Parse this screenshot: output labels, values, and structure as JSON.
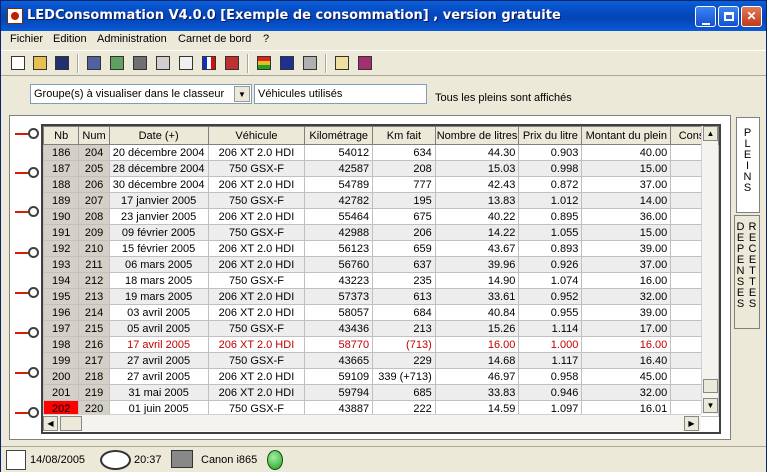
{
  "window": {
    "title": "LEDConsommation V4.0.0 [Exemple de consommation] , version gratuite"
  },
  "menu": [
    "Fichier",
    "Edition",
    "Administration",
    "Carnet de bord",
    "?"
  ],
  "filter": {
    "group_select": "Groupe(s) à visualiser dans le classeur",
    "vehicles_value": "Véhicules utilisés",
    "status": "Tous les pleins sont affichés"
  },
  "table": {
    "columns": [
      "Nb",
      "Num",
      "Date (+)",
      "Véhicule",
      "Kilométrage",
      "Km fait",
      "Nombre de litres",
      "Prix du litre",
      "Montant du plein",
      "Conso"
    ],
    "rows": [
      [
        "186",
        "204",
        "20 décembre 2004",
        "206 XT 2.0 HDI",
        "54012",
        "634",
        "44.30",
        "0.903",
        "40.00"
      ],
      [
        "187",
        "205",
        "28 décembre 2004",
        "750 GSX-F",
        "42587",
        "208",
        "15.03",
        "0.998",
        "15.00"
      ],
      [
        "188",
        "206",
        "30 décembre 2004",
        "206 XT 2.0 HDI",
        "54789",
        "777",
        "42.43",
        "0.872",
        "37.00"
      ],
      [
        "189",
        "207",
        "17 janvier 2005",
        "750 GSX-F",
        "42782",
        "195",
        "13.83",
        "1.012",
        "14.00"
      ],
      [
        "190",
        "208",
        "23 janvier 2005",
        "206 XT 2.0 HDI",
        "55464",
        "675",
        "40.22",
        "0.895",
        "36.00"
      ],
      [
        "191",
        "209",
        "09 février 2005",
        "750 GSX-F",
        "42988",
        "206",
        "14.22",
        "1.055",
        "15.00"
      ],
      [
        "192",
        "210",
        "15 février 2005",
        "206 XT 2.0 HDI",
        "56123",
        "659",
        "43.67",
        "0.893",
        "39.00"
      ],
      [
        "193",
        "211",
        "06 mars 2005",
        "206 XT 2.0 HDI",
        "56760",
        "637",
        "39.96",
        "0.926",
        "37.00"
      ],
      [
        "194",
        "212",
        "18 mars 2005",
        "750 GSX-F",
        "43223",
        "235",
        "14.90",
        "1.074",
        "16.00"
      ],
      [
        "195",
        "213",
        "19 mars 2005",
        "206 XT 2.0 HDI",
        "57373",
        "613",
        "33.61",
        "0.952",
        "32.00"
      ],
      [
        "196",
        "214",
        "03 avril 2005",
        "206 XT 2.0 HDI",
        "58057",
        "684",
        "40.84",
        "0.955",
        "39.00"
      ],
      [
        "197",
        "215",
        "05 avril 2005",
        "750 GSX-F",
        "43436",
        "213",
        "15.26",
        "1.114",
        "17.00"
      ],
      [
        "198",
        "216",
        "17 avril 2005",
        "206 XT 2.0 HDI",
        "58770",
        "(713)",
        "16.00",
        "1.000",
        "16.00"
      ],
      [
        "199",
        "217",
        "27 avril 2005",
        "750 GSX-F",
        "43665",
        "229",
        "14.68",
        "1.117",
        "16.40"
      ],
      [
        "200",
        "218",
        "27 avril 2005",
        "206 XT 2.0 HDI",
        "59109",
        "339 (+713)",
        "46.97",
        "0.958",
        "45.00"
      ],
      [
        "201",
        "219",
        "31 mai 2005",
        "206 XT 2.0 HDI",
        "59794",
        "685",
        "33.83",
        "0.946",
        "32.00"
      ],
      [
        "202",
        "220",
        "01 juin 2005",
        "750 GSX-F",
        "43887",
        "222",
        "14.59",
        "1.097",
        "16.01"
      ]
    ],
    "highlight_row": 12,
    "current_row": 16
  },
  "tabs": {
    "pleins": "PLEINS",
    "depenses": "DEPENSES",
    "recettes": "RECETTES"
  },
  "statusbar": {
    "date": "14/08/2005",
    "time": "20:37",
    "printer": "Canon i865"
  },
  "colors": {
    "highlight_text": "#c00000",
    "current_marker": "#ff0000",
    "status_led": "#20a020"
  }
}
